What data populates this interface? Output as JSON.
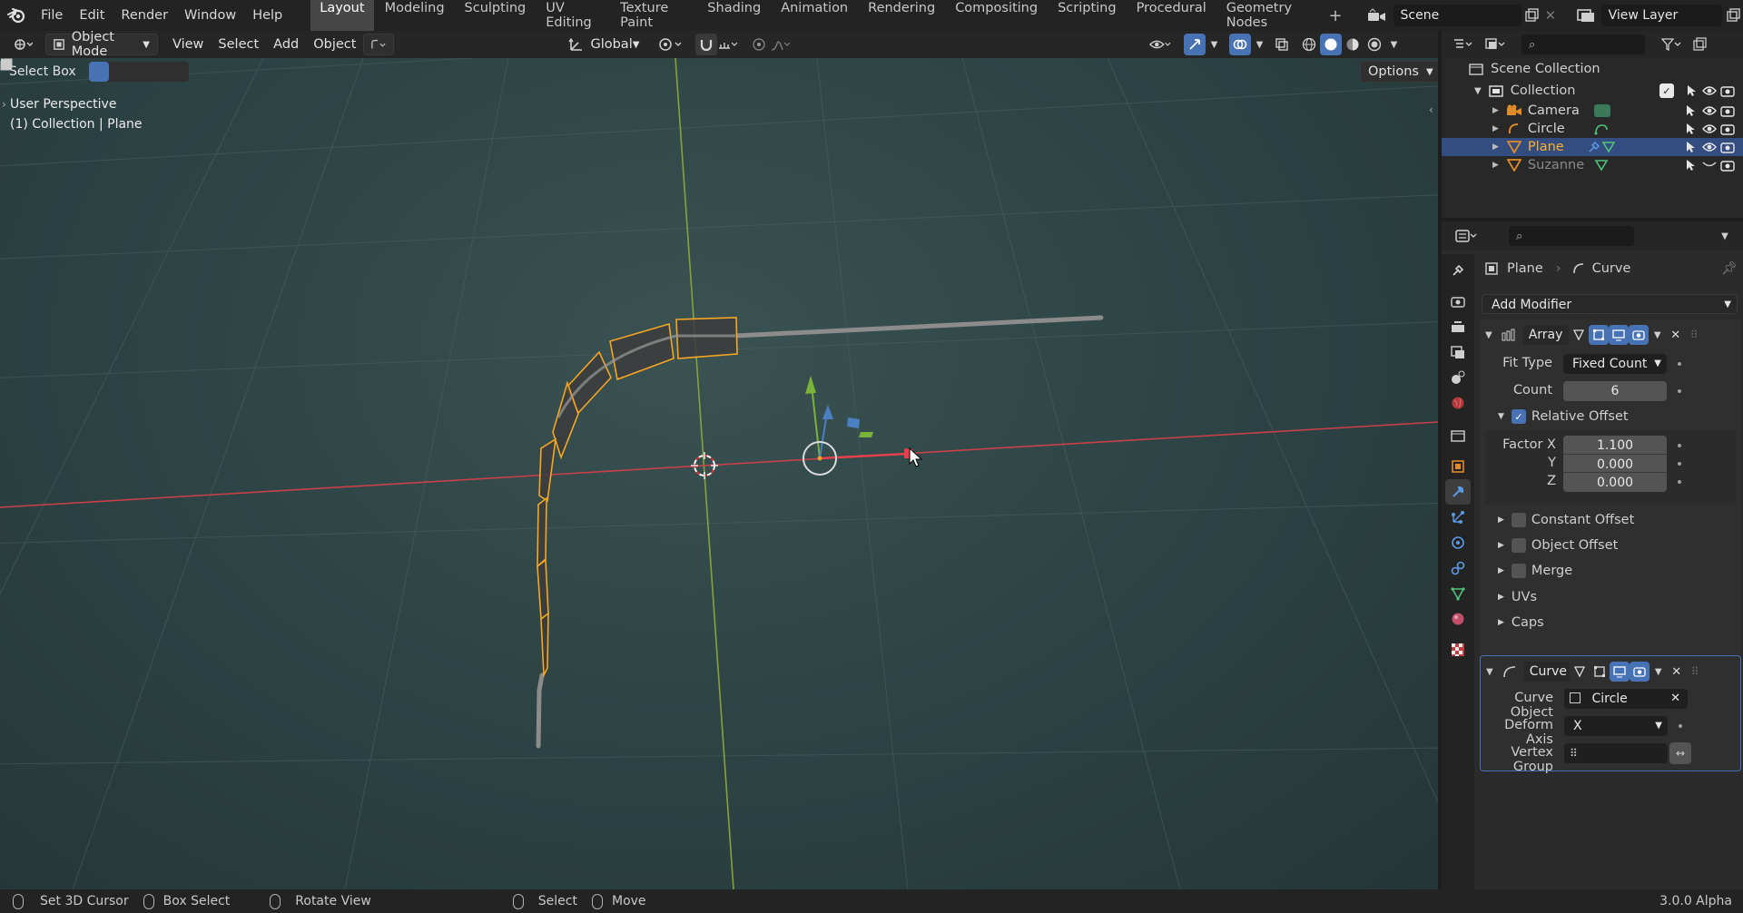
{
  "menu": {
    "file": "File",
    "edit": "Edit",
    "render": "Render",
    "window": "Window",
    "help": "Help"
  },
  "workspaces": [
    "Layout",
    "Modeling",
    "Sculpting",
    "UV Editing",
    "Texture Paint",
    "Shading",
    "Animation",
    "Rendering",
    "Compositing",
    "Scripting",
    "Procedural",
    "Geometry Nodes"
  ],
  "active_workspace": "Layout",
  "scene": {
    "name": "Scene",
    "view_layer": "View Layer"
  },
  "viewport_header": {
    "mode": "Object Mode",
    "view": "View",
    "select": "Select",
    "add": "Add",
    "object": "Object",
    "orientation": "Global",
    "options": "Options"
  },
  "tool_header": {
    "label": "Select Box"
  },
  "viewport_overlay": {
    "perspective": "User Perspective",
    "context": "(1) Collection | Plane"
  },
  "outliner": {
    "root": "Scene Collection",
    "collection": "Collection",
    "items": [
      {
        "name": "Camera",
        "selected": false,
        "dimmed": false
      },
      {
        "name": "Circle",
        "selected": false,
        "dimmed": false
      },
      {
        "name": "Plane",
        "selected": true,
        "dimmed": false
      },
      {
        "name": "Suzanne",
        "selected": false,
        "dimmed": true
      }
    ]
  },
  "properties": {
    "breadcrumb_object": "Plane",
    "breadcrumb_modifier": "Curve",
    "add_modifier": "Add Modifier",
    "array": {
      "name": "Array",
      "fit_type_label": "Fit Type",
      "fit_type": "Fixed Count",
      "count_label": "Count",
      "count": "6",
      "relative_offset": "Relative Offset",
      "factor_x_label": "Factor X",
      "factor_x": "1.100",
      "y_label": "Y",
      "factor_y": "0.000",
      "z_label": "Z",
      "factor_z": "0.000",
      "constant_offset": "Constant Offset",
      "object_offset": "Object Offset",
      "merge": "Merge",
      "uvs": "UVs",
      "caps": "Caps"
    },
    "curve": {
      "name": "Curve",
      "curve_object_label": "Curve Object",
      "curve_object": "Circle",
      "deform_axis_label": "Deform Axis",
      "deform_axis": "X",
      "vertex_group_label": "Vertex Group"
    }
  },
  "statusbar": {
    "set_cursor": "Set 3D Cursor",
    "box_select": "Box Select",
    "rotate_view": "Rotate View",
    "select": "Select",
    "move": "Move",
    "version": "3.0.0 Alpha"
  },
  "colors": {
    "accent": "#4772b3",
    "selection": "#f5a623",
    "x_axis": "#c8404a",
    "y_axis": "#7fa628"
  }
}
